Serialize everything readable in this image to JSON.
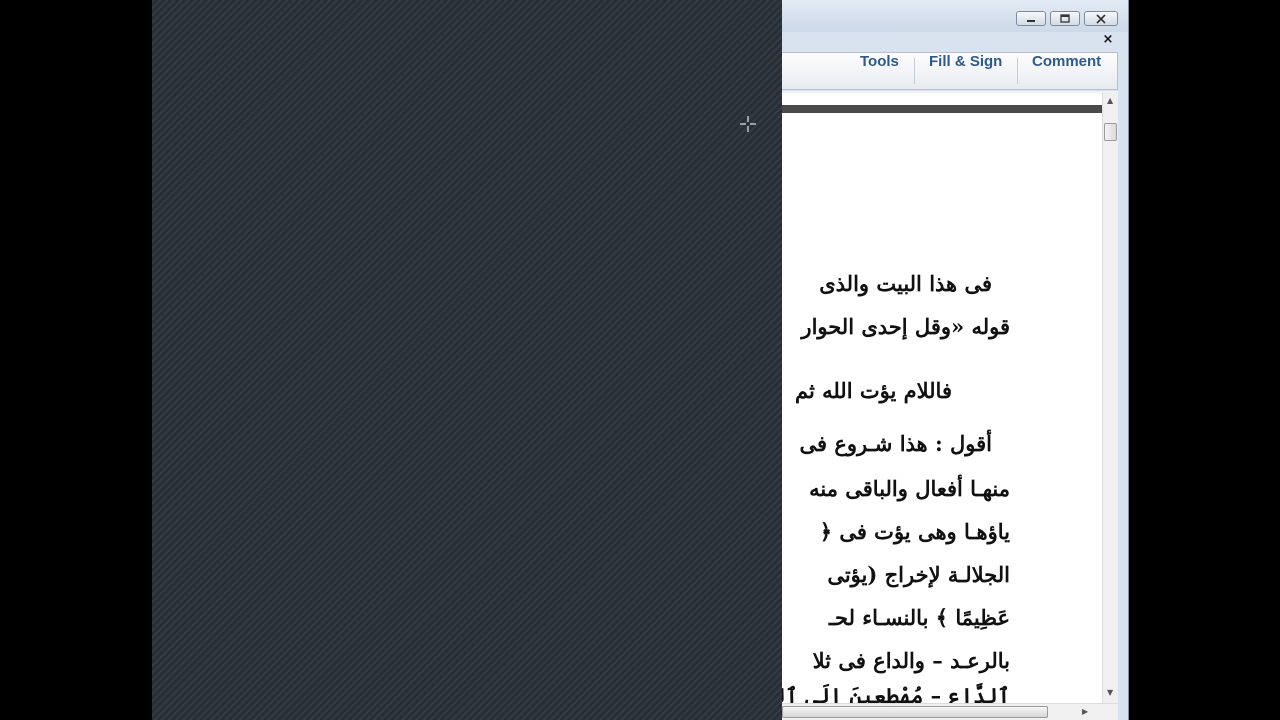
{
  "window": {
    "controls": {
      "minimize": "minimize-icon",
      "restore": "restore-icon",
      "close": "close-icon"
    },
    "doc_close": "×"
  },
  "toolbar": {
    "tools_label": "Tools",
    "fill_sign_label": "Fill & Sign",
    "comment_label": "Comment"
  },
  "document": {
    "lines": [
      "فى هذا البيت والذى",
      "قوله «وقل إحدى الحوار",
      "فاللام يؤت الله ثم",
      "أقول : هذا شـروع فى",
      "منهـا أفعال والباقى منه",
      "ياؤهـا وهى يؤت فى ﴿",
      "الجلالـة لإخراج (يؤتى",
      "عَظِيمًا ﴾ بالنسـاء لحـ",
      "بالرعـد – والداع فى ثلا",
      "ٱلدَّاعِ – مُهْطِعِينَ إِلَى ٱلدَّاعِ ﴿"
    ]
  },
  "colors": {
    "backdrop": "#2b323b",
    "toolbar_text": "#2d5a8c",
    "titlebar": "#d9e3ef"
  }
}
